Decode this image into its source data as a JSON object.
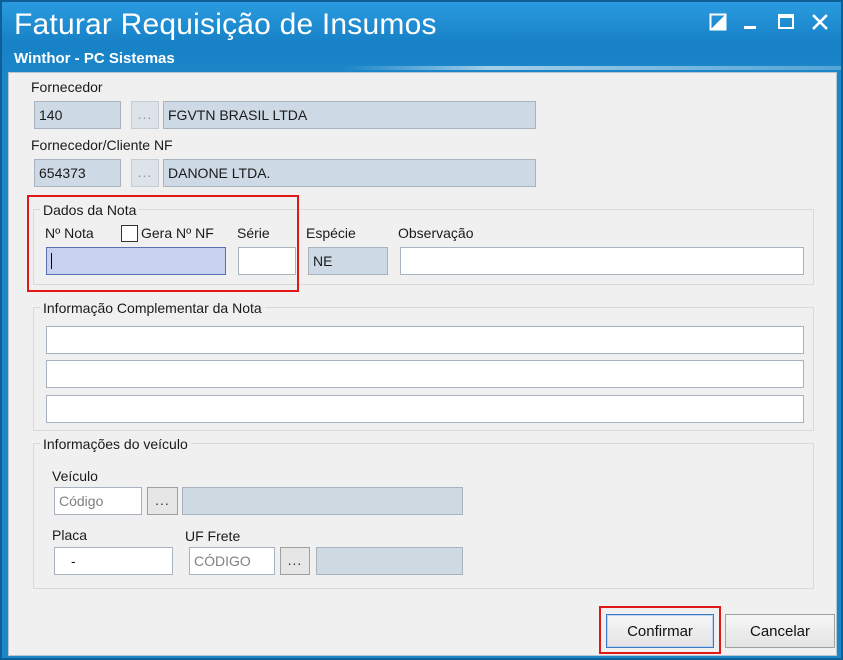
{
  "window": {
    "title": "Faturar Requisição de Insumos",
    "subtitle": "Winthor - PC Sistemas"
  },
  "fornecedor": {
    "label": "Fornecedor",
    "code": "140",
    "button": "...",
    "name": "FGVTN BRASIL LTDA"
  },
  "fornecedor_cliente_nf": {
    "label": "Fornecedor/Cliente NF",
    "code": "654373",
    "button": "...",
    "name": "DANONE LTDA."
  },
  "dados_nota": {
    "title": "Dados da Nota",
    "numero_label": "Nº Nota",
    "numero_value": "",
    "gera_label": "Gera Nº NF",
    "gera_checked": false,
    "serie_label": "Série",
    "serie_value": "",
    "especie_label": "Espécie",
    "especie_value": "NE",
    "observacao_label": "Observação",
    "observacao_value": ""
  },
  "info_complementar": {
    "title": "Informação Complementar da Nota",
    "lines": [
      "",
      "",
      ""
    ]
  },
  "veiculo": {
    "title": "Informações do veículo",
    "veiculo_label": "Veículo",
    "veiculo_placeholder": "Código",
    "veiculo_button": "...",
    "placa_label": "Placa",
    "placa_value": "-",
    "uf_label": "UF Frete",
    "uf_placeholder": "CÓDIGO",
    "uf_button": "..."
  },
  "actions": {
    "confirm": "Confirmar",
    "cancel": "Cancelar"
  },
  "colors": {
    "title_bar": "#1b86c8",
    "highlight": "#e01818",
    "readonly_field": "#cdd9e4",
    "focus_field": "#c7d3ee"
  }
}
